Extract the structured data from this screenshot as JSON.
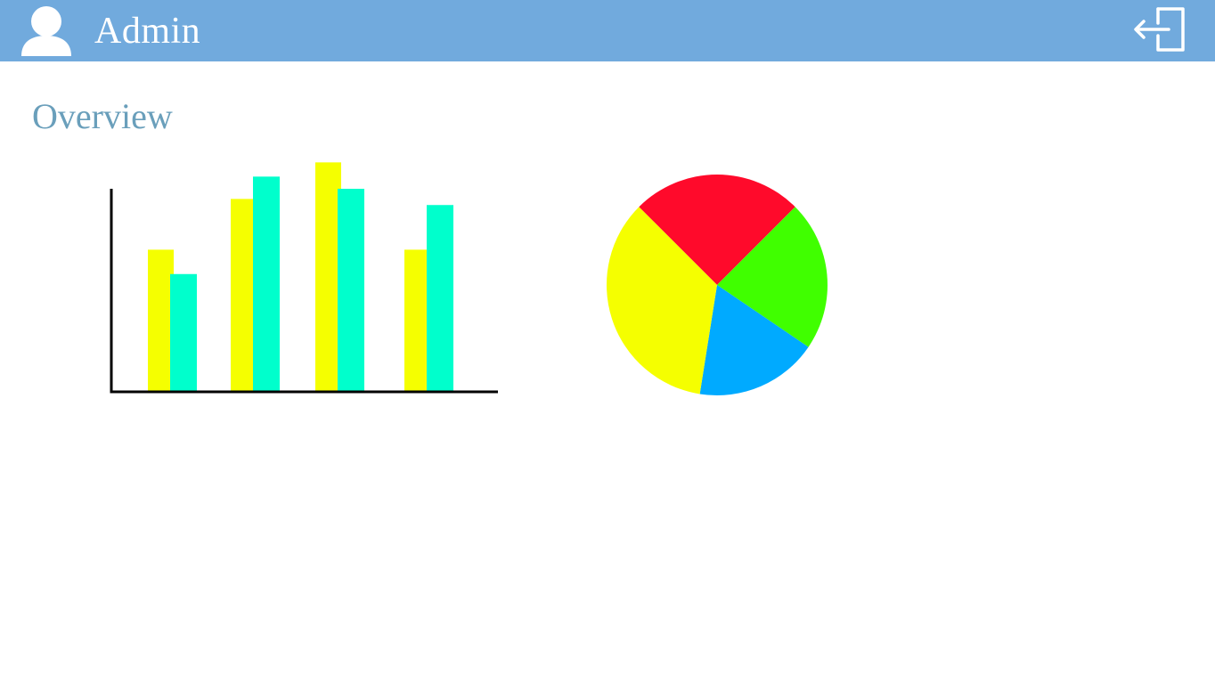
{
  "header": {
    "username": "Admin",
    "background_color": "#71aadd",
    "user_icon": "user-avatar-icon",
    "logout_icon": "logout-icon"
  },
  "main": {
    "title": "Overview",
    "title_color": "#6a9fbb"
  },
  "chart_data": [
    {
      "type": "bar",
      "title": "",
      "xlabel": "",
      "ylabel": "",
      "categories": [
        "",
        "",
        "",
        ""
      ],
      "ylim": [
        0,
        100
      ],
      "grid": false,
      "series": [
        {
          "color": "#f5ff00",
          "values": [
            70,
            95,
            113,
            70
          ]
        },
        {
          "color": "#00ffcc",
          "values": [
            58,
            106,
            100,
            92
          ]
        }
      ]
    },
    {
      "type": "pie",
      "title": "",
      "slices": [
        {
          "color": "#ff0a2b",
          "value": 25
        },
        {
          "color": "#40ff00",
          "value": 22
        },
        {
          "color": "#00aaff",
          "value": 18
        },
        {
          "color": "#f5ff00",
          "value": 35
        }
      ]
    }
  ]
}
